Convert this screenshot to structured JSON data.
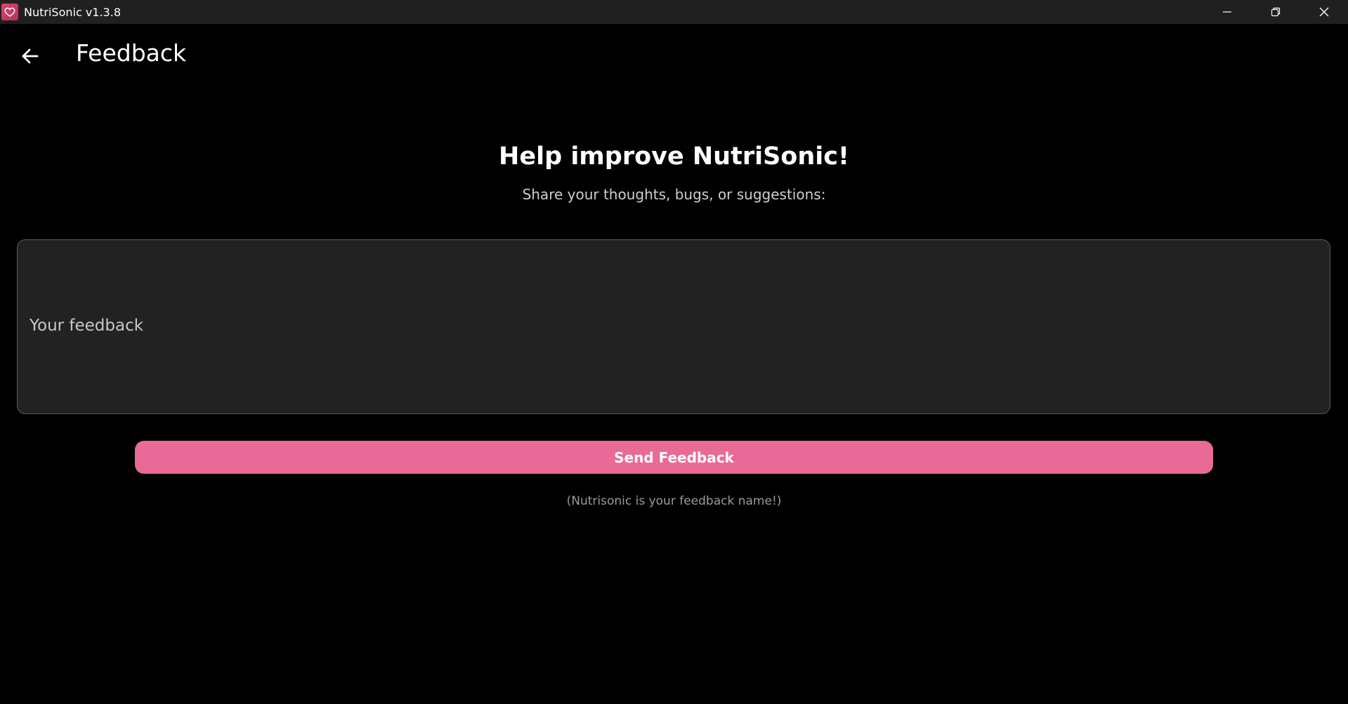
{
  "window": {
    "title": "NutriSonic v1.3.8",
    "icon": "heart-app-icon",
    "controls": [
      "minimize-icon",
      "restore-icon",
      "close-icon"
    ]
  },
  "header": {
    "back_icon": "arrow-left-icon",
    "title": "Feedback"
  },
  "main": {
    "heading": "Help improve NutriSonic!",
    "subheading": "Share your thoughts, bugs, or suggestions:",
    "feedback_field": {
      "placeholder": "Your feedback",
      "value": ""
    },
    "send_button_label": "Send Feedback",
    "footnote": "(Nutrisonic is your feedback name!)"
  },
  "colors": {
    "accent": "#e96a97",
    "background": "#000000",
    "titlebar": "#202020",
    "input_background": "#222222"
  }
}
